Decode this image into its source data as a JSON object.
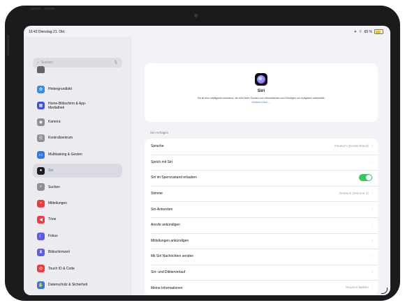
{
  "status": {
    "time": "16:43",
    "date": "Dienstag 21. Okt.",
    "battery": "65 %",
    "battery_level": 0.65
  },
  "search": {
    "placeholder": "Suchen",
    "search_icon": "magnifier-icon",
    "mic_icon": "microphone-icon"
  },
  "sidebar": {
    "items": [
      {
        "label": "",
        "icon": "partial-icon",
        "color": "#636366",
        "glyph": "",
        "selected": false
      },
      {
        "label": "Hintergrundbild",
        "icon": "wallpaper-icon",
        "color": "#2f8fe9",
        "glyph": "✿",
        "selected": false
      },
      {
        "label": "Home-Bildschirm & App-Mediathek",
        "icon": "home-screen-icon",
        "color": "#3c55d6",
        "glyph": "▦",
        "selected": false
      },
      {
        "label": "Kamera",
        "icon": "camera-icon",
        "color": "#8e8e93",
        "glyph": "◉",
        "selected": false
      },
      {
        "label": "Kontrollzentrum",
        "icon": "control-center-icon",
        "color": "#8e8e93",
        "glyph": "☰",
        "selected": false
      },
      {
        "label": "Multitasking & Gesten",
        "icon": "multitasking-icon",
        "color": "#2f7be4",
        "glyph": "▭",
        "selected": false
      },
      {
        "label": "Siri",
        "icon": "siri-icon",
        "color": "#1c1c22",
        "glyph": "●",
        "selected": true
      },
      {
        "label": "Suchen",
        "icon": "search-icon",
        "color": "#8e8e93",
        "glyph": "⌕",
        "selected": false
      },
      {
        "label": "Mitteilungen",
        "icon": "notifications-icon",
        "color": "#ef3b3b",
        "glyph": "▪",
        "selected": false
      },
      {
        "label": "Töne",
        "icon": "sounds-icon",
        "color": "#ef3b4b",
        "glyph": "◀",
        "selected": false
      },
      {
        "label": "Fokus",
        "icon": "focus-icon",
        "color": "#5e5ce6",
        "glyph": "☾",
        "selected": false
      },
      {
        "label": "Bildschirmzeit",
        "icon": "screen-time-icon",
        "color": "#5e5ce6",
        "glyph": "⧗",
        "selected": false
      },
      {
        "label": "Touch ID & Code",
        "icon": "touch-id-icon",
        "color": "#ef3b3b",
        "glyph": "◎",
        "selected": false
      },
      {
        "label": "Datenschutz & Sicherheit",
        "icon": "privacy-hand-icon",
        "color": "#2f7be4",
        "glyph": "✋",
        "selected": false
      }
    ]
  },
  "header": {
    "title": "Siri",
    "description": "Siri ist eine intelligente Assistenz, die dich beim Suchen von Informationen und Erledigen von Aufgaben unterstützt.",
    "link": "Weitere Infos …",
    "logo_icon": "siri-logo-icon"
  },
  "section": {
    "label": "Siri-Anfragen",
    "rows": [
      {
        "label": "Sprache",
        "value": "Deutsch (Deutschland)",
        "type": "nav"
      },
      {
        "label": "Sprich mit Siri",
        "value": "",
        "type": "nav"
      },
      {
        "label": "Siri im Sperrzustand erlauben",
        "value": "",
        "type": "toggle",
        "on": true
      },
      {
        "label": "Stimme",
        "value": "Deutsch (Stimme 2)",
        "type": "nav"
      },
      {
        "label": "Siri-Antworten",
        "value": "",
        "type": "nav"
      },
      {
        "label": "Anrufe ankündigen",
        "value": "",
        "type": "nav"
      },
      {
        "label": "Mitteilungen ankündigen",
        "value": "",
        "type": "nav"
      },
      {
        "label": "Mit Siri Nachrichten senden",
        "value": "",
        "type": "nav"
      },
      {
        "label": "Siri- und Diktierverlauf",
        "value": "",
        "type": "nav"
      },
      {
        "label": "Meine Informationen",
        "value": "Maurice Ballein",
        "type": "nav"
      }
    ]
  },
  "colors": {
    "accent": "#2f7be4",
    "toggle_on": "#34c759"
  }
}
